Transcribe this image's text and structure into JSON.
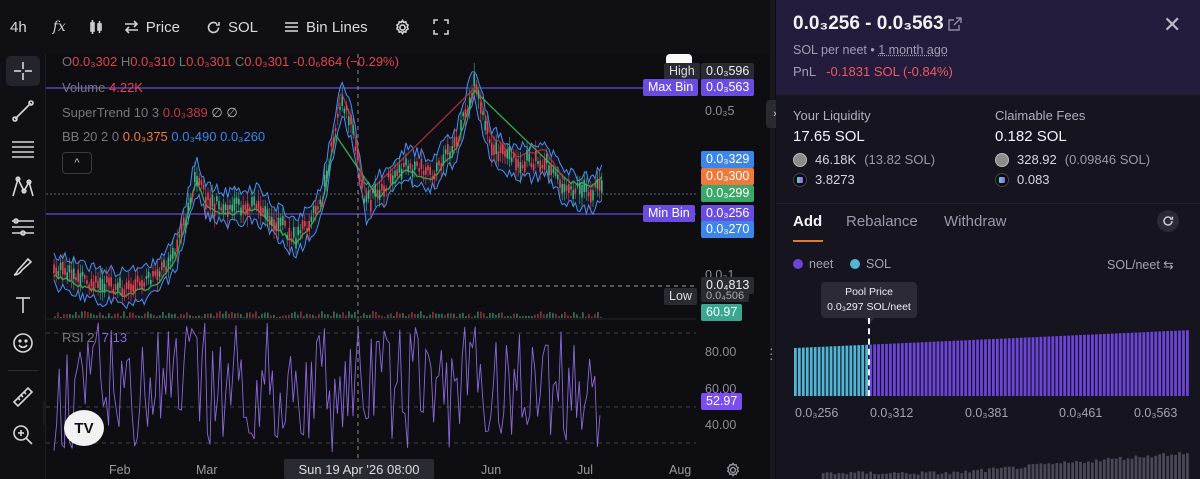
{
  "toolbar": {
    "interval": "4h",
    "fx_label": "fx",
    "price_label": "Price",
    "sol_label": "SOL",
    "binlines_label": "Bin Lines"
  },
  "left_tools": [
    "crosshair-icon",
    "trendline-icon",
    "fib-icon",
    "pattern-icon",
    "projection-icon",
    "brush-icon",
    "text-icon",
    "emoji-icon",
    "ruler-icon",
    "zoom-icon"
  ],
  "legend": {
    "ohlc": {
      "o_label": "O",
      "o": "0.0₃302",
      "h_label": "H",
      "h": "0.0₃310",
      "l_label": "L",
      "l": "0.0₃301",
      "c_label": "C",
      "c": "0.0₃301",
      "change": "-0.0₆864 (−0.29%)"
    },
    "volume": {
      "label": "Volume",
      "value": "4.22K"
    },
    "supertrend": {
      "label": "SuperTrend 10 3",
      "value": "0.0₃389",
      "extra": "∅ ∅"
    },
    "bb": {
      "label": "BB 20 2 0",
      "v1": "0.0₃375",
      "v2": "0.0₃490",
      "v3": "0.0₃260"
    },
    "toggle": "^",
    "more": "···"
  },
  "price_axis": {
    "high_label": "High",
    "high": "0.0₃596",
    "max_bin_label": "Max Bin",
    "max_bin": "0.0₃563",
    "tick_5": "0.0₃5",
    "bb_upper": "0.0₃329",
    "current": "0.0₃300",
    "last": "0.0₃299",
    "min_bin_label": "Min Bin",
    "min_bin": "0.0₃256",
    "bb_lower": "0.0₃270",
    "tick_1": "0.0₃1",
    "low": "0.0₄813",
    "low_label": "Low",
    "low_under": "0.0₄506",
    "volume_tag": "60.97"
  },
  "rsi": {
    "label": "RSI 2",
    "value": "7.13",
    "ticks": [
      "80.00",
      "60.00",
      "40.00"
    ],
    "current": "52.97"
  },
  "time_axis": {
    "labels": [
      "Feb",
      "Mar",
      "Jun",
      "Jul",
      "Aug"
    ],
    "crosshair_date": "Sun 19 Apr '26   08:00"
  },
  "tv_logo": "TV",
  "panel": {
    "range_title": "0.0₃256 - 0.0₃563",
    "meta_unit": "SOL per neet",
    "meta_sep": "•",
    "meta_ago": "1 month ago",
    "pnl_label": "PnL",
    "pnl_value": "-0.1831 SOL (-0.84%)",
    "liquidity": {
      "title": "Your Liquidity",
      "total": "17.65 SOL",
      "neet_amount": "46.18K",
      "neet_sol": "(13.82 SOL)",
      "sol_amount": "3.8273"
    },
    "fees": {
      "title": "Claimable Fees",
      "total": "0.182 SOL",
      "neet_amount": "328.92",
      "neet_sol": "(0.09846 SOL)",
      "sol_amount": "0.083"
    },
    "tabs": [
      "Add",
      "Rebalance",
      "Withdraw"
    ],
    "legend": {
      "neet": "neet",
      "sol": "SOL",
      "pair": "SOL/neet ⇆"
    },
    "tooltip": {
      "title": "Pool Price",
      "value": "0.0₃297 SOL/neet"
    },
    "bin_axis": [
      "0.0₃256",
      "0.0₃312",
      "0.0₃381",
      "0.0₃461",
      "0.0₃563"
    ]
  },
  "colors": {
    "accent_purple": "#7a4ef0",
    "bin_sol": "#4fb6d6",
    "bin_neet": "#6b44d8",
    "negative": "#ef5a60",
    "rsi": "#8b68d8"
  }
}
